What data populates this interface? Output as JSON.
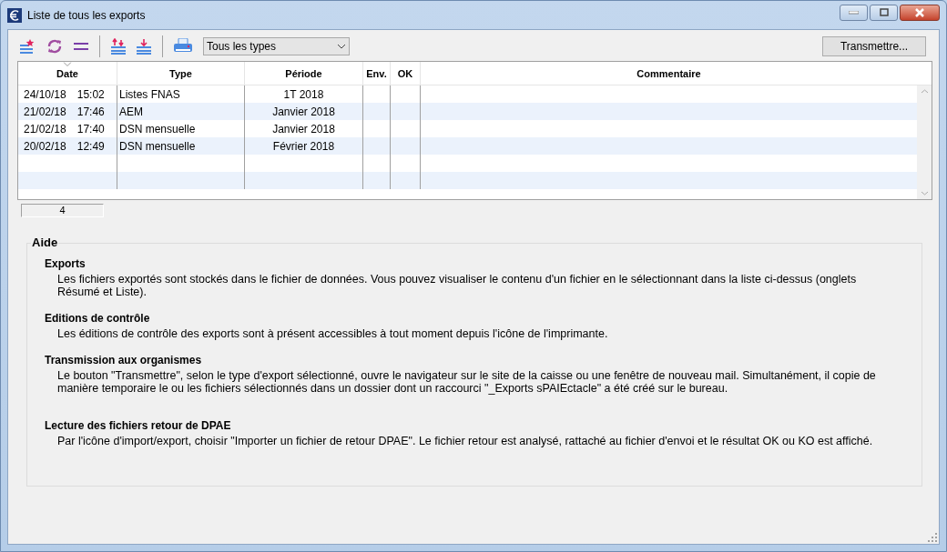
{
  "window": {
    "title": "Liste de tous les exports"
  },
  "toolbar": {
    "type_filter": {
      "value": "Tous les types"
    },
    "transmit_button": "Transmettre..."
  },
  "table": {
    "columns": [
      {
        "label": "Date",
        "sorted": true
      },
      {
        "label": "Type",
        "sorted": false
      },
      {
        "label": "Période",
        "sorted": false
      },
      {
        "label": "Env.",
        "sorted": false
      },
      {
        "label": "OK",
        "sorted": false
      },
      {
        "label": "Commentaire",
        "sorted": false
      }
    ],
    "rows": [
      {
        "date": "24/10/18",
        "time": "15:02",
        "type": "Listes FNAS",
        "period": "1T 2018"
      },
      {
        "date": "21/02/18",
        "time": "17:46",
        "type": "AEM",
        "period": "Janvier 2018"
      },
      {
        "date": "21/02/18",
        "time": "17:40",
        "type": "DSN mensuelle",
        "period": "Janvier 2018"
      },
      {
        "date": "20/02/18",
        "time": "12:49",
        "type": "DSN mensuelle",
        "period": "Février 2018"
      }
    ],
    "count": "4"
  },
  "help": {
    "title": "Aide",
    "sections": [
      {
        "title": "Exports",
        "text": "Les fichiers exportés sont stockés dans le fichier de données. Vous pouvez visualiser le contenu d'un fichier en le sélectionnant dans la liste ci-dessus (onglets Résumé et Liste)."
      },
      {
        "title": "Editions de contrôle",
        "text": "Les éditions de contrôle des exports sont à présent accessibles à tout moment depuis l'icône de l'imprimante."
      },
      {
        "title": "Transmission aux organismes",
        "text": "Le bouton \"Transmettre\", selon le type d'export sélectionné, ouvre le navigateur sur le site de la caisse ou une fenêtre de nouveau mail. Simultanément, il copie de manière temporaire le ou les fichiers sélectionnés dans un dossier dont un raccourci \"_Exports sPAIEctacle\" a été créé sur le bureau."
      },
      {
        "title": "Lecture des fichiers retour de DPAE",
        "text": "Par l'icône d'import/export, choisir \"Importer un fichier de retour DPAE\". Le fichier retour est analysé, rattaché au fichier d'envoi et le résultat OK ou KO est affiché."
      }
    ]
  }
}
